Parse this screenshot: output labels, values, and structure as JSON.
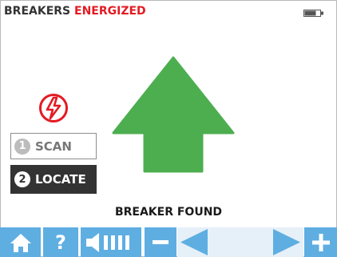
{
  "header": {
    "title_prefix": "BREAKERS ",
    "title_status": "ENERGIZED",
    "status_color": "#e31b23",
    "battery_icon": "battery-icon"
  },
  "modes": {
    "scan": {
      "number": "1",
      "label": "SCAN",
      "selected": false
    },
    "locate": {
      "number": "2",
      "label": "LOCATE",
      "selected": true
    }
  },
  "main": {
    "warning_icon": "high-voltage-icon",
    "direction_icon": "up-arrow-icon",
    "arrow_color": "#4cae4f",
    "result_text": "BREAKER FOUND"
  },
  "toolbar": {
    "accent_color": "#5eaee2",
    "home_icon": "home-icon",
    "help_label": "?",
    "volume_icon": "speaker-icon",
    "volume_bars": 4,
    "decrease_icon": "minus-icon",
    "left_icon": "left-triangle-icon",
    "right_icon": "right-triangle-icon",
    "increase_icon": "plus-icon"
  }
}
